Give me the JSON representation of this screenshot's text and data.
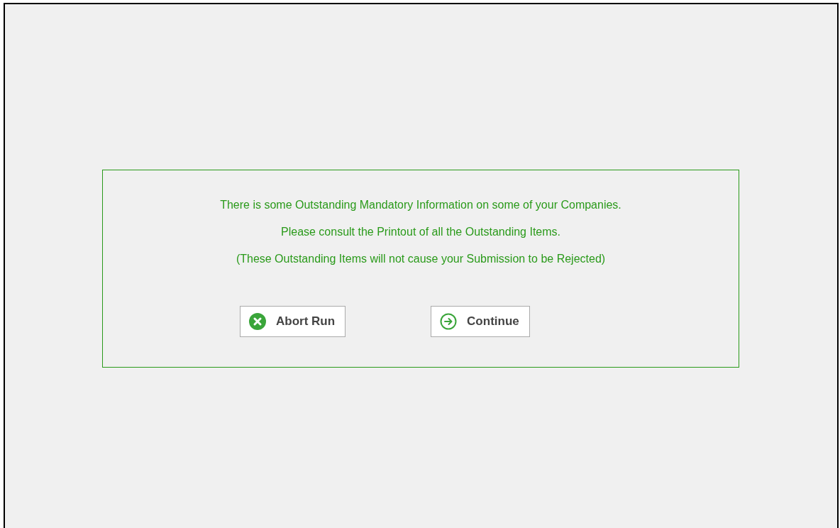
{
  "message": {
    "lines": [
      "There is some Outstanding Mandatory Information on some of your Companies.",
      "Please consult the Printout of all the Outstanding Items.",
      "(These Outstanding Items will not cause your Submission to be Rejected)"
    ]
  },
  "buttons": [
    {
      "kind": "abort",
      "label": "Abort Run"
    },
    {
      "kind": "continue",
      "label": "Continue"
    }
  ]
}
